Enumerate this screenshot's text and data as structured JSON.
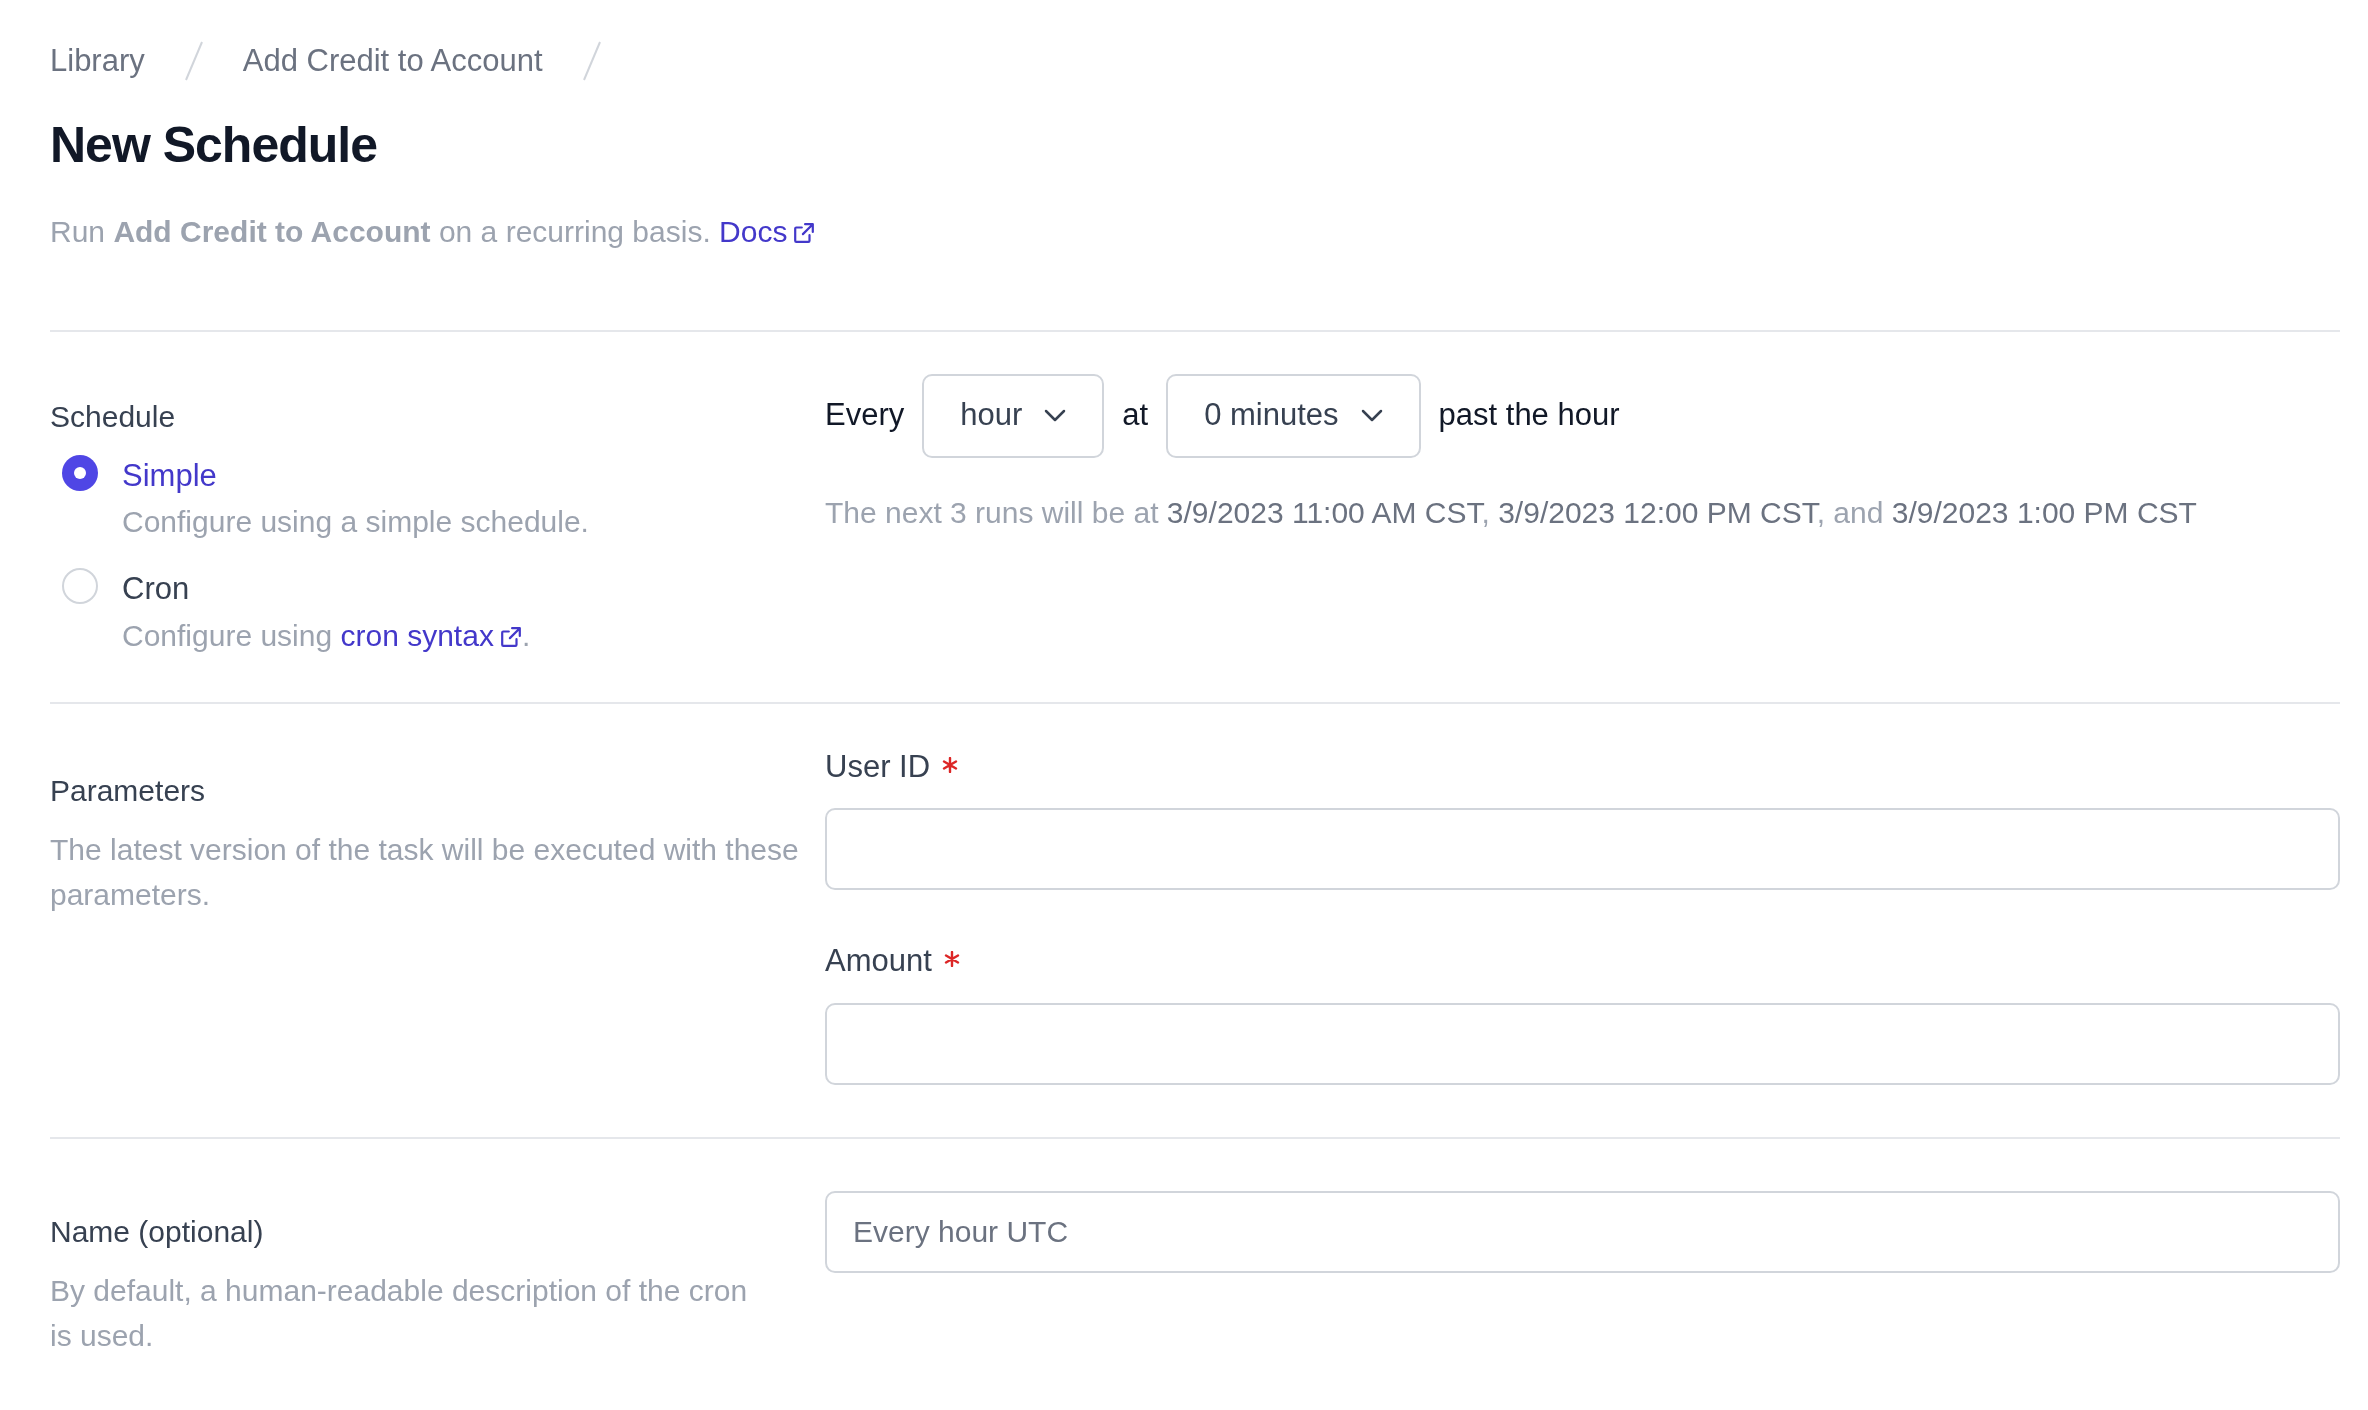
{
  "breadcrumb": [
    {
      "label": "Library"
    },
    {
      "label": "Add Credit to Account"
    }
  ],
  "title": "New Schedule",
  "subtitle": {
    "text": "Run **Add Credit to Account** on a recurring basis.",
    "link": "Docs"
  },
  "schedule": {
    "label": "Schedule",
    "options": [
      {
        "label": "Simple",
        "description": "Configure using a simple schedule.",
        "selected": true
      },
      {
        "label": "Cron",
        "description": "Configure using",
        "link": "cron syntax",
        "suffix": ".",
        "selected": false
      }
    ],
    "every_label": "Every",
    "interval": "hour",
    "at_label": "at",
    "minutes": "0 minutes",
    "suffix": "past the hour",
    "next_runs": [
      {
        "kind": "plain",
        "text": "The next 3 runs will be at "
      },
      {
        "kind": "time",
        "text": "3/9/2023 11:00 AM CST"
      },
      {
        "kind": "plain",
        "text": ", "
      },
      {
        "kind": "time",
        "text": "3/9/2023 12:00 PM CST"
      },
      {
        "kind": "plain",
        "text": ", and "
      },
      {
        "kind": "time",
        "text": "3/9/2023 1:00 PM CST"
      }
    ]
  },
  "parameters": {
    "label": "Parameters",
    "description": "The latest version of the task will be executed with these parameters.",
    "fields": [
      {
        "label": "User ID",
        "required": true
      },
      {
        "label": "Amount",
        "required": true
      }
    ]
  },
  "name": {
    "label": "Name (optional)",
    "description": "By default, a human-readable description of the cron is used.",
    "placeholder": "Every hour UTC"
  }
}
